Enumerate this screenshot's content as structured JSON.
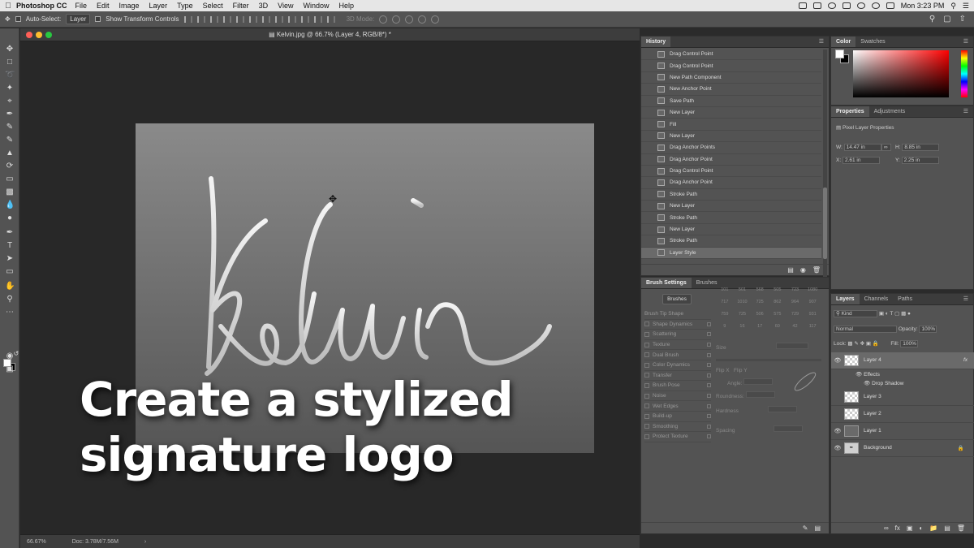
{
  "menubar": {
    "app_name": "Photoshop CC",
    "items": [
      "File",
      "Edit",
      "Image",
      "Layer",
      "Type",
      "Select",
      "Filter",
      "3D",
      "View",
      "Window",
      "Help"
    ],
    "clock": "Mon 3:23 PM"
  },
  "options_bar": {
    "auto_select_label": "Auto-Select:",
    "auto_select_value": "Layer",
    "show_transform_label": "Show Transform Controls",
    "mode_label": "3D Mode:"
  },
  "document": {
    "title": "Kelvin.jpg @ 66.7% (Layer 4, RGB/8*) *",
    "zoom": "66.67%",
    "doc_size": "Doc: 3.78M/7.56M"
  },
  "history": {
    "tab": "History",
    "items": [
      "Drag Control Point",
      "Drag Control Point",
      "New Path Component",
      "New Anchor Point",
      "Save Path",
      "New Layer",
      "Fill",
      "New Layer",
      "Drag Anchor Points",
      "Drag Anchor Point",
      "Drag Control Point",
      "Drag Anchor Point",
      "Stroke Path",
      "New Layer",
      "Stroke Path",
      "New Layer",
      "Stroke Path",
      "Layer Style"
    ]
  },
  "brush_settings": {
    "tabs": [
      "Brush Settings",
      "Brushes"
    ],
    "brushes_button": "Brushes",
    "options": [
      "Brush Tip Shape",
      "Shape Dynamics",
      "Scattering",
      "Texture",
      "Dual Brush",
      "Color Dynamics",
      "Transfer",
      "Brush Pose",
      "Noise",
      "Wet Edges",
      "Build-up",
      "Smoothing",
      "Protect Texture"
    ],
    "tip_sizes": [
      "101",
      "501",
      "568",
      "505",
      "723",
      "1080",
      "717",
      "1010",
      "725",
      "862",
      "964",
      "907",
      "759",
      "725",
      "506",
      "575",
      "729",
      "931",
      "9",
      "16",
      "17",
      "60",
      "42",
      "117"
    ],
    "labels": {
      "size": "Size",
      "flip_x": "Flip X",
      "flip_y": "Flip Y",
      "angle": "Angle:",
      "roundness": "Roundness:",
      "hardness": "Hardness",
      "spacing": "Spacing"
    }
  },
  "color": {
    "tabs": [
      "Color",
      "Swatches"
    ]
  },
  "properties": {
    "tabs": [
      "Properties",
      "Adjustments"
    ],
    "heading": "Pixel Layer Properties",
    "w": "14.47 in",
    "h": "8.85 in",
    "x": "2.61 in",
    "y": "2.25 in",
    "w_label": "W:",
    "h_label": "H:",
    "x_label": "X:",
    "y_label": "Y:"
  },
  "layers": {
    "tabs": [
      "Layers",
      "Channels",
      "Paths"
    ],
    "kind": "Kind",
    "blend_mode": "Normal",
    "opacity_label": "Opacity:",
    "opacity": "100%",
    "lock_label": "Lock:",
    "fill_label": "Fill:",
    "fill": "100%",
    "items": [
      {
        "name": "Layer 4",
        "fx": "fx"
      },
      {
        "name": "Layer 3"
      },
      {
        "name": "Layer 2"
      },
      {
        "name": "Layer 1"
      },
      {
        "name": "Background"
      }
    ],
    "effects_label": "Effects",
    "drop_shadow_label": "Drop Shadow"
  },
  "overlay": {
    "line1": "Create a stylized",
    "line2": "signature logo"
  }
}
